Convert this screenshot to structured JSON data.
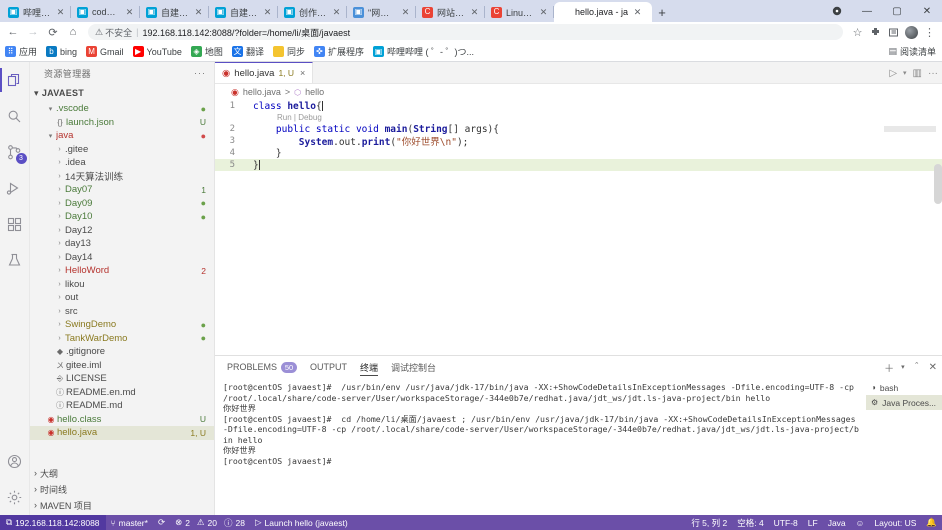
{
  "browser": {
    "tabs": [
      {
        "title": "哔哩哔哩 ( ゜- ゜)つ",
        "favicon": "bilibili-icon",
        "active": false
      },
      {
        "title": "code-server",
        "favicon": "codeserver-icon",
        "active": false
      },
      {
        "title": "自建code-se",
        "favicon": "codeserver-icon",
        "active": false
      },
      {
        "title": "自建code-se",
        "favicon": "codeserver-icon",
        "active": false
      },
      {
        "title": "创作中心 - 哔",
        "favicon": "bilibili-icon",
        "active": false
      },
      {
        "title": "\"网站处于联机",
        "favicon": "image-icon",
        "active": false
      },
      {
        "title": "网站处于联机",
        "favicon": "csdn-icon",
        "active": false
      },
      {
        "title": "Linux关闭防火",
        "favicon": "csdn-icon",
        "active": false
      },
      {
        "title": "hello.java - ja",
        "favicon": "vscode-icon",
        "active": true
      }
    ],
    "new_tab_label": "+",
    "window_controls": [
      "profile",
      "minimize",
      "maximize",
      "close"
    ],
    "nav": {
      "back": "back-icon",
      "forward": "forward-icon",
      "reload": "reload-icon",
      "home": "home-icon"
    },
    "omnibox": {
      "security_label": "不安全",
      "url": "192.168.118.142:8088/?folder=/home/li/桌面/javaest"
    },
    "toolbar_icons": [
      "star-icon",
      "extensions-icon",
      "readinglist-icon",
      "avatar",
      "menu-icon"
    ],
    "bookmarks": [
      {
        "label": "应用",
        "icon": "apps-icon"
      },
      {
        "label": "bing",
        "icon": "bing-icon"
      },
      {
        "label": "Gmail",
        "icon": "gmail-icon"
      },
      {
        "label": "YouTube",
        "icon": "youtube-icon"
      },
      {
        "label": "地图",
        "icon": "maps-icon"
      },
      {
        "label": "翻译",
        "icon": "translate-icon"
      },
      {
        "label": "同步",
        "icon": "folder-icon"
      },
      {
        "label": "扩展程序",
        "icon": "extensions-icon"
      },
      {
        "label": "哔哩哔哩 ( ゜- ゜)つ...",
        "icon": "bilibili-icon"
      }
    ],
    "bookmarks_right": {
      "label": "阅读清单",
      "icon": "readinglist-icon"
    }
  },
  "vscode": {
    "activitybar": [
      {
        "name": "explorer",
        "icon": "files-icon",
        "active": true,
        "badge": ""
      },
      {
        "name": "search",
        "icon": "search-icon",
        "active": false,
        "badge": ""
      },
      {
        "name": "source-control",
        "icon": "source-control-icon",
        "active": false,
        "badge": "3"
      },
      {
        "name": "run-debug",
        "icon": "run-debug-icon",
        "active": false,
        "badge": ""
      },
      {
        "name": "extensions",
        "icon": "extensions-icon",
        "active": false,
        "badge": ""
      },
      {
        "name": "testing",
        "icon": "beaker-icon",
        "active": false,
        "badge": ""
      },
      {
        "name": "accounts",
        "icon": "account-icon",
        "active": false,
        "badge": ""
      },
      {
        "name": "settings",
        "icon": "gear-icon",
        "active": false,
        "badge": ""
      }
    ],
    "sidebar": {
      "title": "资源管理器",
      "more_actions": "···",
      "root_folder": "JAVAEST",
      "tree": [
        {
          "label": ".vscode",
          "depth": 1,
          "type": "folder",
          "expanded": true,
          "color": "green",
          "badge": "",
          "dot": "green"
        },
        {
          "label": "launch.json",
          "depth": 2,
          "type": "json",
          "expanded": null,
          "color": "green",
          "badge": "U",
          "dot": ""
        },
        {
          "label": "java",
          "depth": 1,
          "type": "folder",
          "expanded": true,
          "color": "red",
          "badge": "",
          "dot": "red"
        },
        {
          "label": ".gitee",
          "depth": 2,
          "type": "folder",
          "expanded": false,
          "color": "default",
          "badge": "",
          "dot": ""
        },
        {
          "label": ".idea",
          "depth": 2,
          "type": "folder",
          "expanded": false,
          "color": "default",
          "badge": "",
          "dot": ""
        },
        {
          "label": "14天算法训练",
          "depth": 2,
          "type": "folder",
          "expanded": false,
          "color": "default",
          "badge": "",
          "dot": ""
        },
        {
          "label": "Day07",
          "depth": 2,
          "type": "folder",
          "expanded": false,
          "color": "green",
          "badge": "1",
          "dot": ""
        },
        {
          "label": "Day09",
          "depth": 2,
          "type": "folder",
          "expanded": false,
          "color": "green",
          "badge": "",
          "dot": "green"
        },
        {
          "label": "Day10",
          "depth": 2,
          "type": "folder",
          "expanded": false,
          "color": "green",
          "badge": "",
          "dot": "green"
        },
        {
          "label": "Day12",
          "depth": 2,
          "type": "folder",
          "expanded": false,
          "color": "default",
          "badge": "",
          "dot": ""
        },
        {
          "label": "day13",
          "depth": 2,
          "type": "folder",
          "expanded": false,
          "color": "default",
          "badge": "",
          "dot": ""
        },
        {
          "label": "Day14",
          "depth": 2,
          "type": "folder",
          "expanded": false,
          "color": "default",
          "badge": "",
          "dot": ""
        },
        {
          "label": "HelloWord",
          "depth": 2,
          "type": "folder",
          "expanded": false,
          "color": "red",
          "badge": "2",
          "dot": ""
        },
        {
          "label": "likou",
          "depth": 2,
          "type": "folder",
          "expanded": false,
          "color": "default",
          "badge": "",
          "dot": ""
        },
        {
          "label": "out",
          "depth": 2,
          "type": "folder",
          "expanded": false,
          "color": "default",
          "badge": "",
          "dot": ""
        },
        {
          "label": "src",
          "depth": 2,
          "type": "folder",
          "expanded": false,
          "color": "default",
          "badge": "",
          "dot": ""
        },
        {
          "label": "SwingDemo",
          "depth": 2,
          "type": "folder",
          "expanded": false,
          "color": "yellow",
          "badge": "",
          "dot": "green"
        },
        {
          "label": "TankWarDemo",
          "depth": 2,
          "type": "folder",
          "expanded": false,
          "color": "yellow",
          "badge": "",
          "dot": "green"
        },
        {
          "label": ".gitignore",
          "depth": 2,
          "type": "git",
          "expanded": null,
          "color": "default",
          "badge": "",
          "dot": ""
        },
        {
          "label": "gitee.iml",
          "depth": 2,
          "type": "iml",
          "expanded": null,
          "color": "default",
          "badge": "",
          "dot": ""
        },
        {
          "label": "LICENSE",
          "depth": 2,
          "type": "license",
          "expanded": null,
          "color": "default",
          "badge": "",
          "dot": ""
        },
        {
          "label": "README.en.md",
          "depth": 2,
          "type": "md",
          "expanded": null,
          "color": "default",
          "badge": "",
          "dot": ""
        },
        {
          "label": "README.md",
          "depth": 2,
          "type": "md",
          "expanded": null,
          "color": "default",
          "badge": "",
          "dot": ""
        },
        {
          "label": "hello.class",
          "depth": 1,
          "type": "java",
          "expanded": null,
          "color": "green",
          "badge": "U",
          "dot": ""
        },
        {
          "label": "hello.java",
          "depth": 1,
          "type": "java",
          "expanded": null,
          "color": "yellow",
          "badge": "1, U",
          "dot": "",
          "selected": true
        }
      ],
      "bottom_sections": [
        {
          "label": "大纲"
        },
        {
          "label": "时间线"
        },
        {
          "label": "MAVEN 项目"
        }
      ]
    },
    "editor": {
      "tab": {
        "label": "hello.java",
        "badge": "1, U",
        "close": "×",
        "icon": "java-icon"
      },
      "actions": [
        "run-icon",
        "chevron-down-icon",
        "split-editor-icon",
        "more-actions-icon"
      ],
      "breadcrumb": {
        "file": "hello.java",
        "separator": ">",
        "symbol": "hello",
        "symbol_icon": "class-symbol-icon"
      },
      "codelens": "Run | Debug",
      "lines": [
        {
          "num": "1",
          "segments": [
            {
              "t": "class ",
              "c": "kw"
            },
            {
              "t": "hello",
              "c": "type"
            },
            {
              "t": "{",
              "c": "plain"
            }
          ],
          "highlight": false,
          "caret": true
        },
        {
          "num": "2",
          "segments": [
            {
              "t": "    ",
              "c": "plain"
            },
            {
              "t": "public static void ",
              "c": "kw"
            },
            {
              "t": "main",
              "c": "name"
            },
            {
              "t": "(",
              "c": "plain"
            },
            {
              "t": "String",
              "c": "type"
            },
            {
              "t": "[] args){",
              "c": "plain"
            }
          ],
          "highlight": false,
          "caret": false
        },
        {
          "num": "3",
          "segments": [
            {
              "t": "        ",
              "c": "plain"
            },
            {
              "t": "System",
              "c": "type"
            },
            {
              "t": ".out.",
              "c": "plain"
            },
            {
              "t": "print",
              "c": "name"
            },
            {
              "t": "(",
              "c": "plain"
            },
            {
              "t": "\"你好世界\\n\"",
              "c": "str"
            },
            {
              "t": ");",
              "c": "plain"
            }
          ],
          "highlight": false,
          "caret": false
        },
        {
          "num": "4",
          "segments": [
            {
              "t": "    }",
              "c": "plain"
            }
          ],
          "highlight": false,
          "caret": false
        },
        {
          "num": "5",
          "segments": [
            {
              "t": "}",
              "c": "plain"
            }
          ],
          "highlight": true,
          "caret": true
        }
      ]
    },
    "panel": {
      "tabs": [
        {
          "label": "PROBLEMS",
          "badge": "50",
          "active": false
        },
        {
          "label": "OUTPUT",
          "badge": "",
          "active": false
        },
        {
          "label": "终端",
          "badge": "",
          "active": true
        },
        {
          "label": "调试控制台",
          "badge": "",
          "active": false
        }
      ],
      "actions": [
        "add-terminal-icon",
        "chevron-down-icon",
        "maximize-panel-icon",
        "close-panel-icon"
      ],
      "terminal_text": "[root@centOS javaest]#  /usr/bin/env /usr/java/jdk-17/bin/java -XX:+ShowCodeDetailsInExceptionMessages -Dfile.encoding=UTF-8 -cp /root/.local/share/code-server/User/workspaceStorage/-344e0b7e/redhat.java/jdt_ws/jdt.ls-java-project/bin hello\n你好世界\n[root@centOS javaest]#  cd /home/li/桌面/javaest ; /usr/bin/env /usr/java/jdk-17/bin/java -XX:+ShowCodeDetailsInExceptionMessages -Dfile.encoding=UTF-8 -cp /root/.local/share/code-server/User/workspaceStorage/-344e0b7e/redhat.java/jdt_ws/jdt.ls-java-project/bin hello\n你好世界\n[root@centOS javaest]# ",
      "terminal_list": [
        {
          "label": "bash",
          "icon": "terminal-icon",
          "active": false
        },
        {
          "label": "Java Proces...",
          "icon": "debug-icon",
          "active": true
        }
      ]
    },
    "statusbar": {
      "remote": {
        "icon": "remote-icon",
        "label": "192.168.118.142:8088"
      },
      "branch": {
        "icon": "git-branch-icon",
        "label": "master*"
      },
      "sync": {
        "icon": "sync-icon",
        "label": ""
      },
      "errors": {
        "icon": "error-icon",
        "label": "2"
      },
      "warnings": {
        "icon": "warning-icon",
        "label": "20"
      },
      "infos": {
        "icon": "info-icon",
        "label": "28"
      },
      "launch": {
        "icon": "run-icon",
        "label": "Launch hello (javaest)"
      },
      "cursor": "行 5, 列 2",
      "indent": "空格: 4",
      "encoding": "UTF-8",
      "eol": "LF",
      "language": "Java",
      "feedback_icon": "smiley-icon",
      "layout": "Layout: US",
      "notifications_icon": "bell-icon"
    }
  },
  "colors": {
    "accent": "#5b4fc4",
    "statusbar_bg": "#6b4fa8",
    "selection": "#e4e6d7",
    "highlight_line": "#e9f2db",
    "badge": "#9b8fd6",
    "java_red": "#c9322c"
  }
}
